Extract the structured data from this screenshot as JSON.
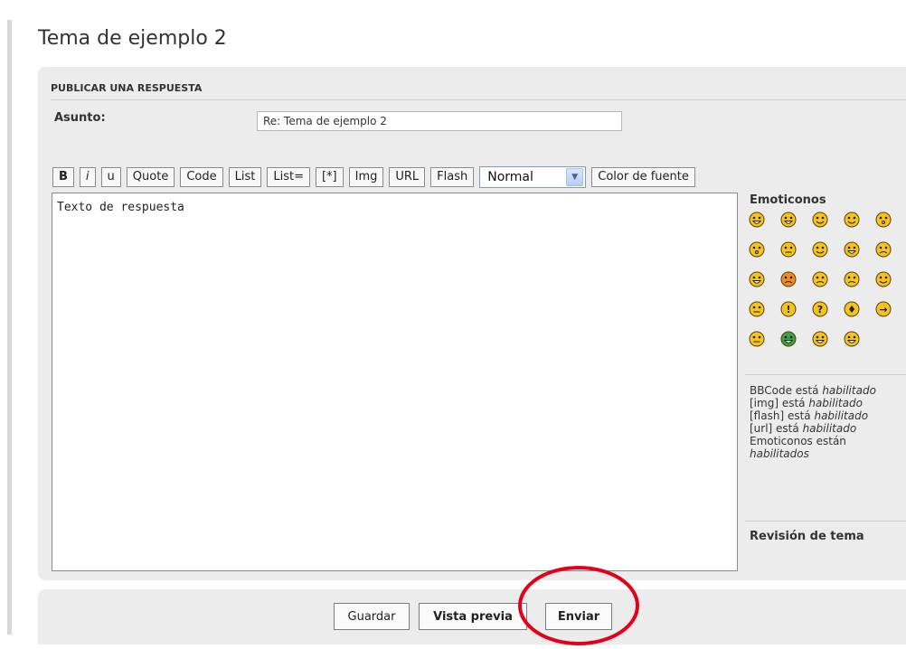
{
  "page": {
    "title": "Tema de ejemplo 2"
  },
  "post_form": {
    "heading": "PUBLICAR UNA RESPUESTA",
    "subject_label": "Asunto:",
    "subject_value": "Re: Tema de ejemplo 2"
  },
  "toolbar": {
    "bold": "B",
    "italic": "i",
    "underline": "u",
    "quote": "Quote",
    "code": "Code",
    "list": "List",
    "list_ordered": "List=",
    "list_item": "[*]",
    "img": "Img",
    "url": "URL",
    "flash": "Flash",
    "font_size_selected": "Normal",
    "font_color": "Color de fuente"
  },
  "editor": {
    "text": "Texto de respuesta"
  },
  "smilies": {
    "title": "Emoticonos",
    "icons": [
      "smiley-grin-icon",
      "smiley-happy-icon",
      "smiley-smile-icon",
      "smiley-wink-icon",
      "smiley-surprised-icon",
      "smiley-shocked-icon",
      "smiley-confused-icon",
      "smiley-cool-icon",
      "smiley-laughing-icon",
      "smiley-mad-icon",
      "smiley-razz-icon",
      "smiley-embarrassed-icon",
      "smiley-sad-icon",
      "smiley-evil-icon",
      "smiley-twisted-icon",
      "smiley-rolleyes-icon",
      "smiley-exclaim-icon",
      "smiley-question-icon",
      "smiley-idea-icon",
      "smiley-arrow-icon",
      "smiley-neutral-icon",
      "smiley-mrgreen-icon",
      "smiley-geek-icon",
      "smiley-ugeek-icon"
    ]
  },
  "bbcode_status": {
    "bbcode": "BBCode está",
    "bbcode_state": "habilitado",
    "img": "[img] está",
    "img_state": "habilitado",
    "flash": "[flash] está",
    "flash_state": "habilitado",
    "url": "[url] está",
    "url_state": "habilitado",
    "smilies": "Emoticonos están",
    "smilies_state": "habilitados"
  },
  "topic_review": "Revisión de tema",
  "actions": {
    "save": "Guardar",
    "preview": "Vista previa",
    "submit": "Enviar"
  },
  "colors": {
    "panel_bg": "#ececec",
    "highlight_ring": "#e4001b",
    "smiley_yellow": "#f6c31c",
    "smiley_green": "#3aa04a"
  }
}
